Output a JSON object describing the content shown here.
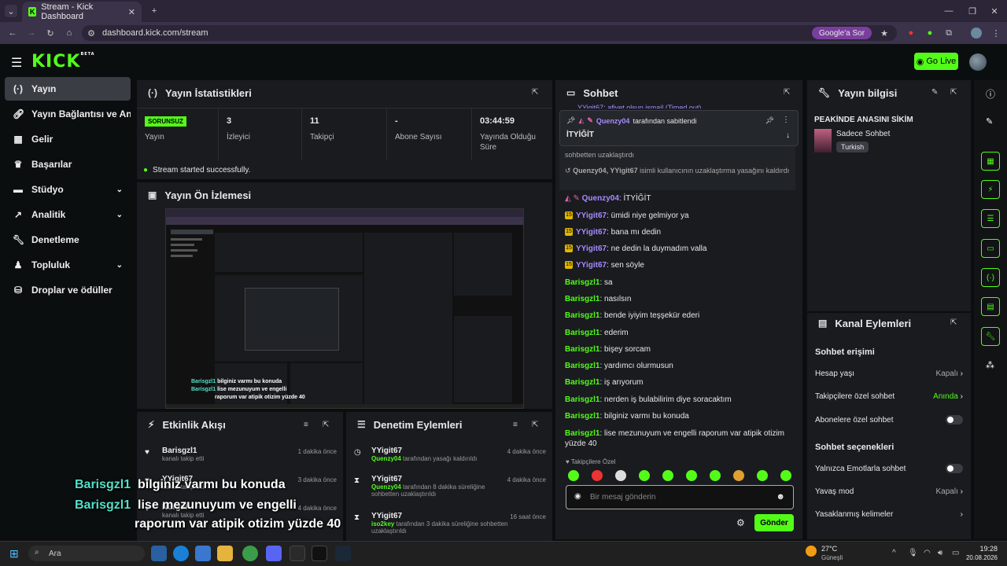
{
  "browser": {
    "tab_title": "Stream - Kick Dashboard",
    "url": "dashboard.kick.com/stream",
    "google_btn": "Google'a Sor"
  },
  "header": {
    "logo": "KICK",
    "logo_badge": "BETA",
    "go_live": "Go Live"
  },
  "sidebar": {
    "items": [
      {
        "label": "Yayın",
        "icon": "broadcast-icon"
      },
      {
        "label": "Yayın Bağlantısı ve Anahtar",
        "icon": "link-icon"
      },
      {
        "label": "Gelir",
        "icon": "chart-icon"
      },
      {
        "label": "Başarılar",
        "icon": "trophy-icon"
      },
      {
        "label": "Stüdyo",
        "icon": "studio-icon"
      },
      {
        "label": "Analitik",
        "icon": "analytics-icon"
      },
      {
        "label": "Denetleme",
        "icon": "wrench-icon"
      },
      {
        "label": "Topluluk",
        "icon": "community-icon"
      },
      {
        "label": "Droplar ve ödüller",
        "icon": "gift-icon"
      }
    ]
  },
  "stats": {
    "title": "Yayın İstatistikleri",
    "status_badge": "SORUNSUZ",
    "status_label": "Yayın",
    "viewers_value": "3",
    "viewers_label": "İzleyici",
    "followers_value": "11",
    "followers_label": "Takipçi",
    "subs_value": "-",
    "subs_label": "Abone Sayısı",
    "duration_value": "03:44:59",
    "duration_label": "Yayında Olduğu Süre",
    "success_msg": "Stream started successfully."
  },
  "preview": {
    "title": "Yayın Ön İzlemesi",
    "mini_caption_1_user": "Barisgzl1",
    "mini_caption_1_text": "bilginiz varmı bu konuda",
    "mini_caption_2_user": "Barisgzl1",
    "mini_caption_2_text": "lise mezunuyum ve engelli",
    "mini_caption_3_text": "raporum var atipik otizim yüzde 40"
  },
  "activity": {
    "title": "Etkinlik Akışı",
    "rows": [
      {
        "user": "Barisgzl1",
        "action": "kanalı takip etti",
        "time": "1 dakika önce"
      },
      {
        "user": "YYigit67",
        "action": "kanalı takip etti",
        "time": "3 dakika önce"
      },
      {
        "user": "Nurgul",
        "action": "kanalı takip etti",
        "time": "4 dakika önce"
      }
    ]
  },
  "moderation": {
    "title": "Denetim Eylemleri",
    "rows": [
      {
        "user": "YYigit67",
        "actor": "Quenzy04",
        "text": "tarafından yasağı kaldırıldı",
        "time": "4 dakika önce"
      },
      {
        "user": "YYigit67",
        "actor": "Quenzy04",
        "text": "tarafından 8 dakika süreliğine sohbetten uzaklaştırıldı",
        "time": "4 dakika önce"
      },
      {
        "user": "YYigit67",
        "actor": "iso2key",
        "text": "tarafından 3 dakika süreliğine sohbetten uzaklaştırıldı",
        "time": "16 saat önce"
      }
    ]
  },
  "chat": {
    "title": "Sohbet",
    "top_cut": "YYigit67: afiyet olsun ismail (Timed out)",
    "pinned_by_user": "Quenzy04",
    "pinned_by_text": "tarafından sabitlendi",
    "pinned_msg": "İTYİĞİT",
    "removed_text": "sohbetten uzaklaştırdı",
    "unban_user": "Quenzy04, YYigit67",
    "unban_text": "isimli kullanıcının uzaklaştırma yasağını kaldırdı",
    "messages": [
      {
        "user": "Quenzy04",
        "text": "İTYİĞİT"
      },
      {
        "user": "YYigit67",
        "text": "ümidi niye gelmiyor ya"
      },
      {
        "user": "YYigit67",
        "text": "bana mı dedin"
      },
      {
        "user": "YYigit67",
        "text": "ne dedin la duymadım valla"
      },
      {
        "user": "YYigit67",
        "text": "sen söyle"
      },
      {
        "user": "Barisgzl1",
        "text": "sa"
      },
      {
        "user": "Barisgzl1",
        "text": "nasılsın"
      },
      {
        "user": "Barisgzl1",
        "text": "bende iyiyim teşşekür ederi"
      },
      {
        "user": "Barisgzl1",
        "text": "ederim"
      },
      {
        "user": "Barisgzl1",
        "text": "bişey sorcam"
      },
      {
        "user": "Barisgzl1",
        "text": "yardımcı olurmusun"
      },
      {
        "user": "Barisgzl1",
        "text": "iş arıyorum"
      },
      {
        "user": "Barisgzl1",
        "text": "nerden iş bulabilirim diye soracaktım"
      },
      {
        "user": "Barisgzl1",
        "text": "bilginiz varmı bu konuda"
      },
      {
        "user": "Barisgzl1",
        "text": "lise mezunuyum ve engelli raporum var atipik otizim yüzde 40"
      }
    ],
    "followers_only": "Takipçilere Özel",
    "input_placeholder": "Bir mesaj gönderin",
    "send": "Gönder"
  },
  "stream_info": {
    "title": "Yayın bilgisi",
    "stream_title": "PEAKİNDE ANASINI SİKİM",
    "category": "Sadece Sohbet",
    "language": "Turkish"
  },
  "channel_actions": {
    "title": "Kanal Eylemleri",
    "chat_access": "Sohbet erişimi",
    "account_age": "Hesap yaşı",
    "account_age_value": "Kapalı",
    "followers_chat": "Takipçilere özel sohbet",
    "followers_chat_value": "Anında",
    "subs_chat": "Abonelere özel sohbet",
    "chat_options": "Sohbet seçenekleri",
    "emote_only": "Yalnızca Emotlarla sohbet",
    "slow_mode": "Yavaş mod",
    "slow_mode_value": "Kapalı",
    "banned_words": "Yasaklanmış kelimeler"
  },
  "captions": {
    "line1_user": "Barisgzl1",
    "line1_text": "bilginiz varmı bu konuda",
    "line2_user": "Barisgzl1",
    "line2_text": "lise mezunuyum ve engelli",
    "line3_text": "raporum var atipik otizim yüzde 40"
  },
  "taskbar": {
    "search": "Ara",
    "weather_temp": "27°C",
    "weather_desc": "Güneşli",
    "time": "19:28",
    "date": "20.08.2026"
  },
  "colors": {
    "accent": "#53fc18",
    "panel": "#191b1f",
    "bg": "#0b0e0f"
  }
}
